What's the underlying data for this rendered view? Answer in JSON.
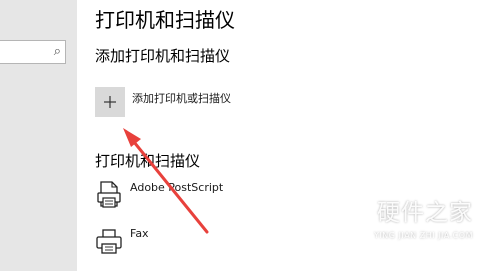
{
  "page": {
    "title": "打印机和扫描仪"
  },
  "add_section": {
    "heading": "添加打印机和扫描仪",
    "button_label": "添加打印机或扫描仪",
    "button_icon": "plus-icon"
  },
  "devices_section": {
    "heading": "打印机和扫描仪",
    "items": [
      {
        "label": "Adobe PostScript",
        "icon": "document-printer-icon"
      },
      {
        "label": "Fax",
        "icon": "printer-icon"
      }
    ]
  },
  "sidebar": {
    "search_icon": "search-icon"
  },
  "watermark": {
    "text": "硬件之家",
    "subtext": "YING JIAN ZHI JIA.COM"
  },
  "colors": {
    "arrow": "#e8413c",
    "tile_background": "#d9d9d9",
    "sidebar_background": "#e6e6e6"
  }
}
